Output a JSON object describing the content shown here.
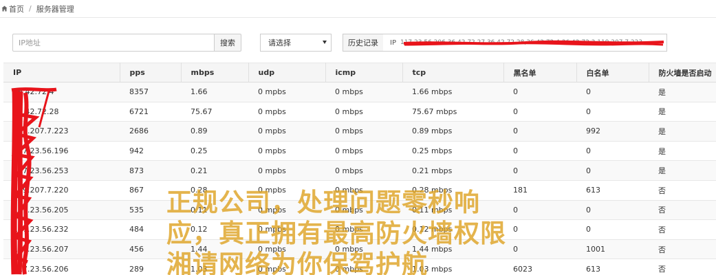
{
  "breadcrumb": {
    "home": "首页",
    "separator": "/",
    "current": "服务器管理"
  },
  "toolbar": {
    "search_placeholder": "IP地址",
    "search_button": "搜索",
    "select_value": "请选择",
    "history_label": "历史记录",
    "history_prefix": "IP",
    "history_text": "117.23.56.206,36.42.72.27,36.42.72.28,36.42.72.4,36.42.72.3,119.207.7.223,"
  },
  "table": {
    "columns": [
      "IP",
      "pps",
      "mbps",
      "udp",
      "icmp",
      "tcp",
      "黑名单",
      "白名单",
      "防火墙是否启动"
    ],
    "rows": [
      [
        "36.42.72.4",
        "8357",
        "1.66",
        "0 mpbs",
        "0 mbps",
        "1.66 mbps",
        "0",
        "0",
        "是"
      ],
      [
        "36.42.72.28",
        "6721",
        "75.67",
        "0 mpbs",
        "0 mbps",
        "75.67 mbps",
        "0",
        "0",
        "是"
      ],
      [
        "119.207.7.223",
        "2686",
        "0.89",
        "0 mpbs",
        "0 mbps",
        "0.89 mbps",
        "0",
        "992",
        "是"
      ],
      [
        "117.23.56.196",
        "942",
        "0.25",
        "0 mpbs",
        "0 mbps",
        "0.25 mbps",
        "0",
        "0",
        "是"
      ],
      [
        "117.23.56.253",
        "873",
        "0.21",
        "0 mpbs",
        "0 mbps",
        "0.21 mbps",
        "0",
        "0",
        "是"
      ],
      [
        "119.207.7.220",
        "867",
        "0.28",
        "0 mpbs",
        "0 mbps",
        "0.28 mbps",
        "181",
        "613",
        "否"
      ],
      [
        "117.23.56.205",
        "535",
        "0.11",
        "0 mpbs",
        "0 mbps",
        "0.11 mbps",
        "0",
        "0",
        "否"
      ],
      [
        "117.23.56.232",
        "484",
        "0.12",
        "0 mpbs",
        "0 mbps",
        "0.12 mbps",
        "0",
        "0",
        "否"
      ],
      [
        "117.23.56.207",
        "456",
        "1.44",
        "0 mpbs",
        "0 mbps",
        "1.44 mbps",
        "0",
        "1001",
        "否"
      ],
      [
        "117.23.56.206",
        "289",
        "1.03",
        "0 mpbs",
        "0 mbps",
        "1.03 mbps",
        "6023",
        "613",
        "否"
      ]
    ]
  },
  "watermark": {
    "line1": "正规公司，处理问题零秒响",
    "line2": "应，真正拥有最高防火墙权限",
    "line3": "湘请网络为你保驾护航"
  },
  "colors": {
    "redaction": "#e8141b",
    "watermark": "#dea326",
    "header_bg": "#f5f5f5",
    "border": "#dddddd"
  }
}
